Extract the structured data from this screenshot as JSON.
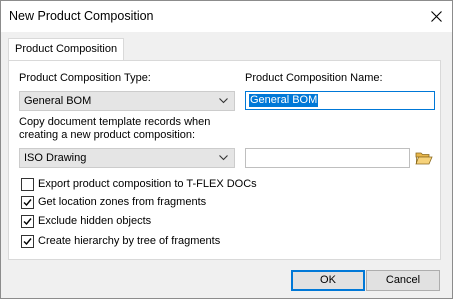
{
  "window": {
    "title": "New Product Composition"
  },
  "tabs": [
    {
      "label": "Product Composition",
      "active": true
    }
  ],
  "form": {
    "type_label": "Product Composition Type:",
    "type_value": "General BOM",
    "name_label": "Product Composition Name:",
    "name_value": "General BOM",
    "copy_label_line1": "Copy document template records when",
    "copy_label_line2": "creating a new product composition:",
    "template_value": "ISO Drawing",
    "template_path": ""
  },
  "checkboxes": [
    {
      "label": "Export product composition to T-FLEX DOCs",
      "checked": false
    },
    {
      "label": "Get location zones from fragments",
      "checked": true
    },
    {
      "label": "Exclude hidden objects",
      "checked": true
    },
    {
      "label": "Create hierarchy by tree of fragments",
      "checked": true
    }
  ],
  "buttons": {
    "ok": "OK",
    "cancel": "Cancel"
  },
  "icons": {
    "close": "close-icon",
    "dropdown": "chevron-down-icon",
    "browse": "folder-open-icon",
    "check": "checkmark-icon"
  },
  "colors": {
    "accent": "#0078d7",
    "combo_bg": "#e5e5e5",
    "dialog_bg": "#f0f0f0"
  }
}
